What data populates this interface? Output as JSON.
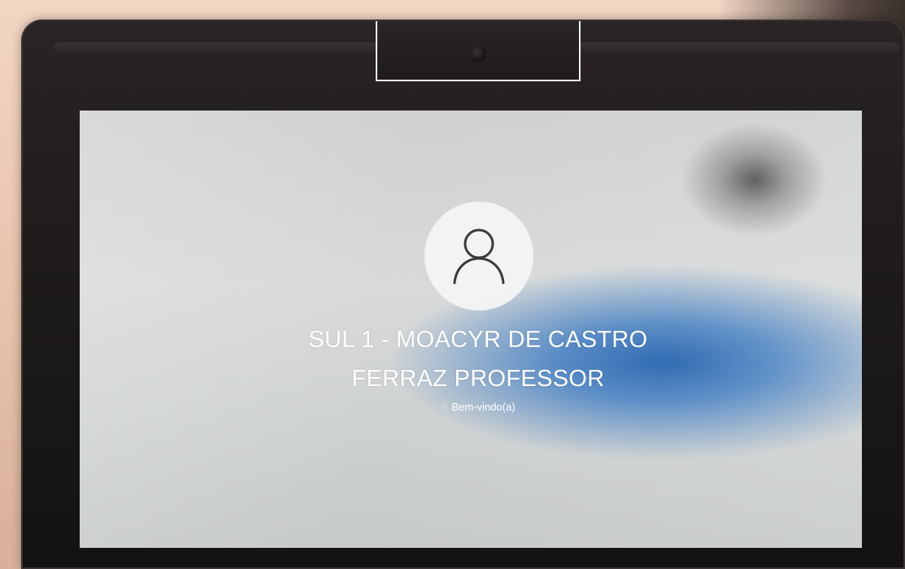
{
  "lock_screen": {
    "user_name_line1": "SUL 1 - MOACYR DE CASTRO",
    "user_name_line2": "FERRAZ PROFESSOR",
    "status_text": "Bem-vindo(a)",
    "avatar_icon": "user-icon",
    "spinner_icon": "loading-spinner-icon"
  }
}
